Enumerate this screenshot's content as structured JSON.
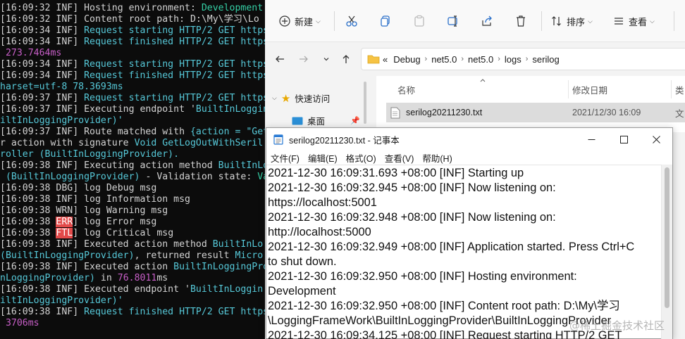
{
  "console": {
    "lines": [
      [
        {
          "t": "[16:09:32 INF] Hosting environment: ",
          "c": "default"
        },
        {
          "t": "Development",
          "c": "teal"
        }
      ],
      [
        {
          "t": "[16:09:32 INF] Content root path: D:\\My\\学习\\Lo",
          "c": "default"
        }
      ],
      [
        {
          "t": "[16:09:34 INF] ",
          "c": "default"
        },
        {
          "t": "Request starting HTTP/2 GET https",
          "c": "cyan"
        }
      ],
      [
        {
          "t": "[16:09:34 INF] ",
          "c": "default"
        },
        {
          "t": "Request finished HTTP/2 GET https",
          "c": "cyan"
        }
      ],
      [
        {
          "t": " 273.7464ms",
          "c": "magenta"
        }
      ],
      [
        {
          "t": "[16:09:34 INF] ",
          "c": "default"
        },
        {
          "t": "Request starting HTTP/2 GET https",
          "c": "cyan"
        }
      ],
      [
        {
          "t": "[16:09:34 INF] ",
          "c": "default"
        },
        {
          "t": "Request finished HTTP/2 GET https",
          "c": "cyan"
        }
      ],
      [
        {
          "t": "harset=utf-8 78.3693ms",
          "c": "cyan"
        }
      ],
      [
        {
          "t": "[16:09:37 INF] ",
          "c": "default"
        },
        {
          "t": "Request starting HTTP/2 GET https",
          "c": "cyan"
        }
      ],
      [
        {
          "t": "[16:09:37 INF] Executing endpoint '",
          "c": "default"
        },
        {
          "t": "BuiltInLoggingP",
          "c": "cyan"
        }
      ],
      [
        {
          "t": "iltInLoggingProvider)'",
          "c": "cyan"
        }
      ],
      [
        {
          "t": "[16:09:37 INF] Route matched with ",
          "c": "default"
        },
        {
          "t": "{action = \"Get",
          "c": "cyan"
        }
      ],
      [
        {
          "t": "r action with signature ",
          "c": "default"
        },
        {
          "t": "Void GetLogOutWithSeril",
          "c": "cyan"
        }
      ],
      [
        {
          "t": "roller (BuiltInLoggingProvider).",
          "c": "cyan"
        }
      ],
      [
        {
          "t": "[16:09:38 INF] Executing action method ",
          "c": "default"
        },
        {
          "t": "BuiltInLo",
          "c": "cyan"
        }
      ],
      [
        {
          "t": " (BuiltInLoggingProvider)",
          "c": "cyan"
        },
        {
          "t": " - Validation state: ",
          "c": "default"
        },
        {
          "t": "Va",
          "c": "teal"
        }
      ],
      [
        {
          "t": "[16:09:38 DBG] log Debug msg",
          "c": "default"
        }
      ],
      [
        {
          "t": "[16:09:38 INF] log Information msg",
          "c": "default"
        }
      ],
      [
        {
          "t": "[16:09:38 WRN] log Warning msg",
          "c": "default"
        }
      ],
      [
        {
          "t": "[16:09:38 ",
          "c": "default"
        },
        {
          "t": "ERR",
          "c": "err"
        },
        {
          "t": "] log Error msg",
          "c": "default"
        }
      ],
      [
        {
          "t": "[16:09:38 ",
          "c": "default"
        },
        {
          "t": "FTL",
          "c": "err"
        },
        {
          "t": "] log Critical msg",
          "c": "default"
        }
      ],
      [
        {
          "t": "[16:09:38 INF] Executed action method ",
          "c": "default"
        },
        {
          "t": "BuiltInLo",
          "c": "cyan"
        }
      ],
      [
        {
          "t": "(BuiltInLoggingProvider)",
          "c": "cyan"
        },
        {
          "t": ", returned result ",
          "c": "default"
        },
        {
          "t": "Micro",
          "c": "cyan"
        }
      ],
      [
        {
          "t": "[16:09:38 INF] Executed action ",
          "c": "default"
        },
        {
          "t": "BuiltInLoggingPro",
          "c": "cyan"
        }
      ],
      [
        {
          "t": "nLoggingProvider)",
          "c": "cyan"
        },
        {
          "t": " in ",
          "c": "default"
        },
        {
          "t": "76.8011",
          "c": "magenta"
        },
        {
          "t": "ms",
          "c": "default"
        }
      ],
      [
        {
          "t": "[16:09:38 INF] Executed endpoint '",
          "c": "default"
        },
        {
          "t": "BuiltInLoggin",
          "c": "cyan"
        }
      ],
      [
        {
          "t": "iltInLoggingProvider)'",
          "c": "cyan"
        }
      ],
      [
        {
          "t": "[16:09:38 INF] ",
          "c": "default"
        },
        {
          "t": "Request finished HTTP/2 GET https",
          "c": "cyan"
        }
      ],
      [
        {
          "t": " 3706ms",
          "c": "magenta"
        }
      ]
    ]
  },
  "explorer": {
    "toolbar": {
      "new_label": "新建",
      "sort_label": "排序",
      "view_label": "查看"
    },
    "breadcrumbs": [
      "Debug",
      "net5.0",
      "net5.0",
      "logs",
      "serilog"
    ],
    "breadcrumb_prefix": "«",
    "sidebar": {
      "quick_access": "快速访问",
      "desktop": "桌面"
    },
    "columns": {
      "name": "名称",
      "modified": "修改日期",
      "type": "类"
    },
    "file": {
      "name": "serilog20211230.txt",
      "modified": "2021/12/30 16:09",
      "type": "文"
    }
  },
  "notepad": {
    "title": "serilog20211230.txt - 记事本",
    "menu": [
      "文件(F)",
      "编辑(E)",
      "格式(O)",
      "查看(V)",
      "帮助(H)"
    ],
    "lines": [
      "2021-12-30 16:09:31.693 +08:00 [INF] Starting up",
      "2021-12-30 16:09:32.945 +08:00 [INF] Now listening on:",
      "https://localhost:5001",
      "2021-12-30 16:09:32.948 +08:00 [INF] Now listening on:",
      "http://localhost:5000",
      "2021-12-30 16:09:32.949 +08:00 [INF] Application started. Press Ctrl+C",
      "to shut down.",
      "2021-12-30 16:09:32.950 +08:00 [INF] Hosting environment:",
      "Development",
      "2021-12-30 16:09:32.950 +08:00 [INF] Content root path: D:\\My\\学习",
      "\\LoggingFrameWork\\BuiltInLoggingProvider\\BuiltInLoggingProvider",
      "2021-12-30 16:09:34.125 +08:00 [INF] Request starting HTTP/2 GET"
    ]
  },
  "watermark": "@稀土掘金技术社区"
}
